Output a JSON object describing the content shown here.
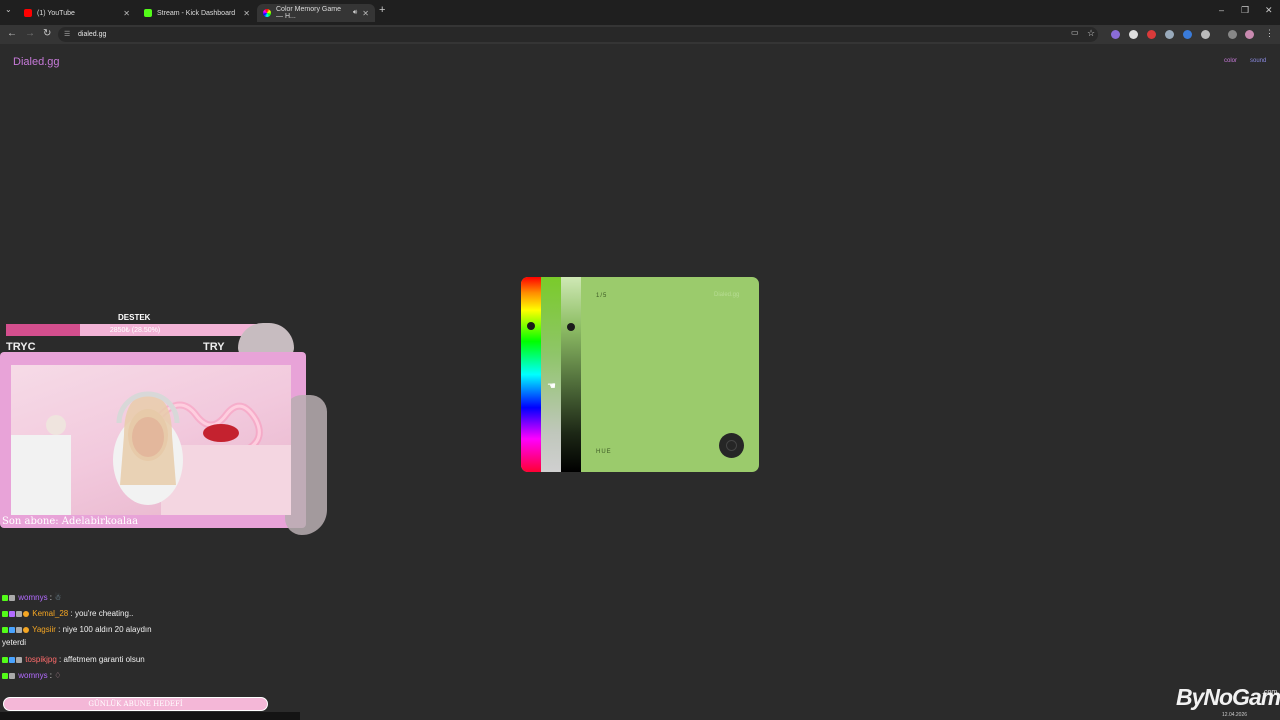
{
  "browser": {
    "tabs": [
      {
        "title": "(1) YouTube",
        "color": "#ff0000"
      },
      {
        "title": "Stream - Kick Dashboard",
        "color": "#53fc18"
      },
      {
        "title": "Color Memory Game — H...",
        "color": "#cc66dd"
      }
    ],
    "url": "dialed.gg"
  },
  "site": {
    "logo": "Dialed.gg",
    "nav_color": "color",
    "nav_sound": "sound"
  },
  "game": {
    "round": "1/5",
    "brand": "Dialed.gg",
    "mode_label": "HUE",
    "target_color": "#9bcb6c"
  },
  "overlay": {
    "destek_title": "DESTEK",
    "goal_text": "2850₺ (28.50%)",
    "goal_progress": 0.285,
    "tryc_left": "TRYC",
    "tryc_right": "TRY",
    "last_sub": "Son abone: Adelabirkoalaa",
    "daily_goal": "GÜNLÜK ABUNE HEDEFİ"
  },
  "chat": [
    {
      "user": "womnys",
      "sep": " : ",
      "text": "",
      "user_color": "#b36bff"
    },
    {
      "user": "Kemal_28",
      "sep": " : ",
      "text": "you're cheating..",
      "user_color": "#f5a623"
    },
    {
      "user": "Yagsiir",
      "sep": " : ",
      "text": "niye 100 aldın 20 alaydın",
      "user_color": "#f5a623"
    },
    {
      "user": "tospikjpg",
      "sep": " : ",
      "text": "affetmem garanti olsun",
      "user_color": "#ff6b6b"
    },
    {
      "user": "womnys",
      "sep": " : ",
      "text": "",
      "user_color": "#b36bff"
    }
  ],
  "chat_continuation": "yeterdi",
  "watermark": {
    "brand": "ByNoGame",
    "suffix": ".com",
    "date": "12.04.2026"
  }
}
